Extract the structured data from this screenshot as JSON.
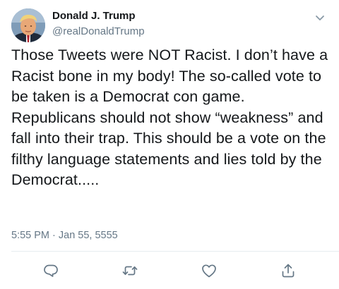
{
  "tweet": {
    "display_name": "Donald J. Trump",
    "handle": "@realDonaldTrump",
    "text": "Those Tweets were NOT Racist. I don’t have a Racist bone in my body! The so-called vote to be taken is a Democrat con game. Republicans should not show “weakness” and fall into their trap. This should be a vote on the filthy language statements and lies told by the Democrat.....",
    "timestamp": "5:55 PM · Jan 55, 5555"
  },
  "icons": {
    "menu": "chevron-down-icon",
    "reply": "reply-icon",
    "retweet": "retweet-icon",
    "like": "heart-icon",
    "share": "share-icon"
  },
  "colors": {
    "text": "#14171a",
    "secondary": "#657786",
    "divider": "#e6ecf0"
  }
}
